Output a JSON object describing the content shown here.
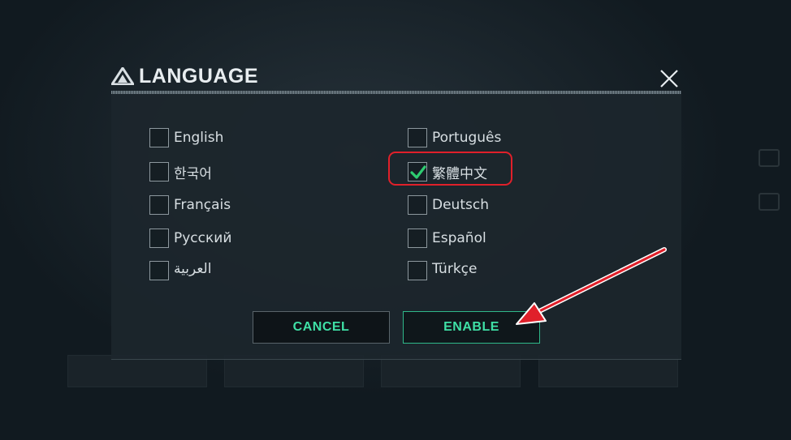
{
  "dialog": {
    "title": "LANGUAGE",
    "icons": {
      "title": "warning-triangle-icon",
      "close": "close-icon"
    }
  },
  "languages": {
    "left": [
      {
        "label": "English",
        "checked": false
      },
      {
        "label": "한국어",
        "checked": false
      },
      {
        "label": "Français",
        "checked": false
      },
      {
        "label": "Русский",
        "checked": false
      },
      {
        "label": "العربية",
        "checked": false
      }
    ],
    "right": [
      {
        "label": "Português",
        "checked": false
      },
      {
        "label": "繁體中文",
        "checked": true
      },
      {
        "label": "Deutsch",
        "checked": false
      },
      {
        "label": "Español",
        "checked": false
      },
      {
        "label": "Türkçe",
        "checked": false
      }
    ]
  },
  "buttons": {
    "cancel": "CANCEL",
    "enable": "ENABLE"
  },
  "colors": {
    "accent": "#3fe0a6",
    "check": "#2ecc71",
    "annotation": "#e0202a"
  }
}
